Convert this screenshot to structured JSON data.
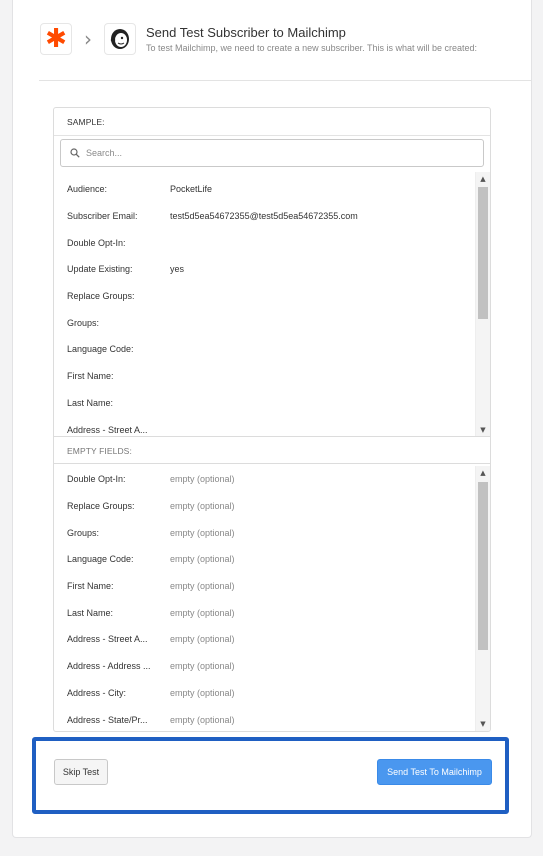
{
  "header": {
    "title": "Send Test Subscriber to Mailchimp",
    "subtitle": "To test Mailchimp, we need to create a new subscriber. This is what will be created:",
    "source_icon": "zapier-icon",
    "target_icon": "mailchimp-icon"
  },
  "sample": {
    "heading": "SAMPLE:",
    "search_placeholder": "Search...",
    "rows": [
      {
        "key": "Audience:",
        "value": "PocketLife"
      },
      {
        "key": "Subscriber Email:",
        "value": "test5d5ea54672355@test5d5ea54672355.com"
      },
      {
        "key": "Double Opt-In:",
        "value": ""
      },
      {
        "key": "Update Existing:",
        "value": "yes"
      },
      {
        "key": "Replace Groups:",
        "value": ""
      },
      {
        "key": "Groups:",
        "value": ""
      },
      {
        "key": "Language Code:",
        "value": ""
      },
      {
        "key": "First Name:",
        "value": ""
      },
      {
        "key": "Last Name:",
        "value": ""
      },
      {
        "key": "Address - Street A...",
        "value": ""
      }
    ]
  },
  "empty_fields": {
    "heading": "EMPTY FIELDS:",
    "rows": [
      {
        "key": "Double Opt-In:",
        "value": "empty (optional)"
      },
      {
        "key": "Replace Groups:",
        "value": "empty (optional)"
      },
      {
        "key": "Groups:",
        "value": "empty (optional)"
      },
      {
        "key": "Language Code:",
        "value": "empty (optional)"
      },
      {
        "key": "First Name:",
        "value": "empty (optional)"
      },
      {
        "key": "Last Name:",
        "value": "empty (optional)"
      },
      {
        "key": "Address - Street A...",
        "value": "empty (optional)"
      },
      {
        "key": "Address - Address ...",
        "value": "empty (optional)"
      },
      {
        "key": "Address - City:",
        "value": "empty (optional)"
      },
      {
        "key": "Address - State/Pr...",
        "value": "empty (optional)"
      }
    ]
  },
  "footer": {
    "skip_label": "Skip Test",
    "send_label": "Send Test To Mailchimp"
  },
  "colors": {
    "accent_blue": "#4a97ef",
    "highlight_border": "#1f5fc2",
    "zapier_orange": "#ff4a00"
  }
}
